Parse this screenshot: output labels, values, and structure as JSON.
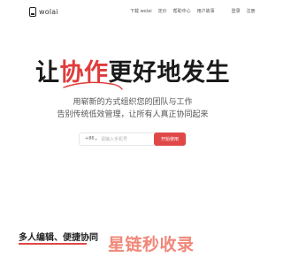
{
  "header": {
    "logo_text": "wolai",
    "nav": [
      "下载 wolai",
      "定价",
      "帮助中心",
      "用户故事",
      "登录",
      "注册"
    ]
  },
  "hero": {
    "headline_before": "让",
    "headline_accent": "协作",
    "headline_after": "更好地发生",
    "sub_line1": "用崭新的方式组织您的团队与工作",
    "sub_line2": "告别传统低效管理，让所有人真正协同起来"
  },
  "signup": {
    "country_code": "+86",
    "phone_placeholder": "请输入手机号",
    "start_label": "开始使用"
  },
  "feature": {
    "title": "多人编辑、便捷协同"
  },
  "watermark": {
    "text": "星链秒收录"
  },
  "colors": {
    "accent": "#e04848",
    "watermark": "#ef7b6a"
  }
}
